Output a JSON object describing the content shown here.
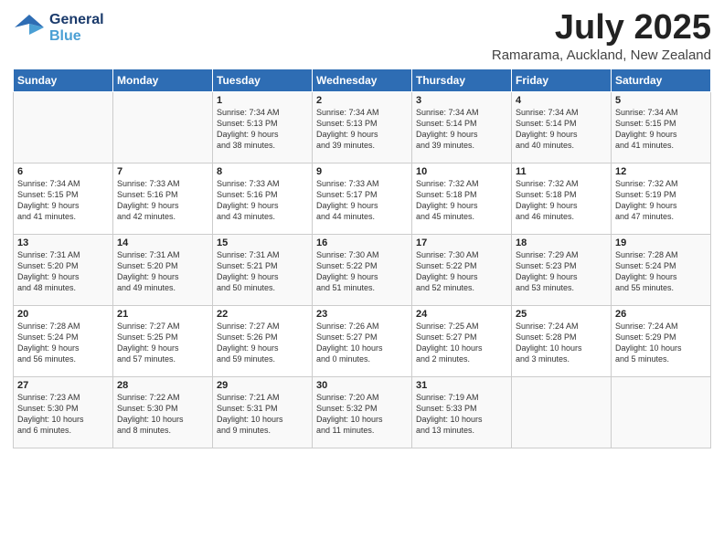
{
  "header": {
    "logo_line1": "General",
    "logo_line2": "Blue",
    "month": "July 2025",
    "location": "Ramarama, Auckland, New Zealand"
  },
  "days_of_week": [
    "Sunday",
    "Monday",
    "Tuesday",
    "Wednesday",
    "Thursday",
    "Friday",
    "Saturday"
  ],
  "weeks": [
    [
      {
        "day": "",
        "info": ""
      },
      {
        "day": "",
        "info": ""
      },
      {
        "day": "1",
        "info": "Sunrise: 7:34 AM\nSunset: 5:13 PM\nDaylight: 9 hours\nand 38 minutes."
      },
      {
        "day": "2",
        "info": "Sunrise: 7:34 AM\nSunset: 5:13 PM\nDaylight: 9 hours\nand 39 minutes."
      },
      {
        "day": "3",
        "info": "Sunrise: 7:34 AM\nSunset: 5:14 PM\nDaylight: 9 hours\nand 39 minutes."
      },
      {
        "day": "4",
        "info": "Sunrise: 7:34 AM\nSunset: 5:14 PM\nDaylight: 9 hours\nand 40 minutes."
      },
      {
        "day": "5",
        "info": "Sunrise: 7:34 AM\nSunset: 5:15 PM\nDaylight: 9 hours\nand 41 minutes."
      }
    ],
    [
      {
        "day": "6",
        "info": "Sunrise: 7:34 AM\nSunset: 5:15 PM\nDaylight: 9 hours\nand 41 minutes."
      },
      {
        "day": "7",
        "info": "Sunrise: 7:33 AM\nSunset: 5:16 PM\nDaylight: 9 hours\nand 42 minutes."
      },
      {
        "day": "8",
        "info": "Sunrise: 7:33 AM\nSunset: 5:16 PM\nDaylight: 9 hours\nand 43 minutes."
      },
      {
        "day": "9",
        "info": "Sunrise: 7:33 AM\nSunset: 5:17 PM\nDaylight: 9 hours\nand 44 minutes."
      },
      {
        "day": "10",
        "info": "Sunrise: 7:32 AM\nSunset: 5:18 PM\nDaylight: 9 hours\nand 45 minutes."
      },
      {
        "day": "11",
        "info": "Sunrise: 7:32 AM\nSunset: 5:18 PM\nDaylight: 9 hours\nand 46 minutes."
      },
      {
        "day": "12",
        "info": "Sunrise: 7:32 AM\nSunset: 5:19 PM\nDaylight: 9 hours\nand 47 minutes."
      }
    ],
    [
      {
        "day": "13",
        "info": "Sunrise: 7:31 AM\nSunset: 5:20 PM\nDaylight: 9 hours\nand 48 minutes."
      },
      {
        "day": "14",
        "info": "Sunrise: 7:31 AM\nSunset: 5:20 PM\nDaylight: 9 hours\nand 49 minutes."
      },
      {
        "day": "15",
        "info": "Sunrise: 7:31 AM\nSunset: 5:21 PM\nDaylight: 9 hours\nand 50 minutes."
      },
      {
        "day": "16",
        "info": "Sunrise: 7:30 AM\nSunset: 5:22 PM\nDaylight: 9 hours\nand 51 minutes."
      },
      {
        "day": "17",
        "info": "Sunrise: 7:30 AM\nSunset: 5:22 PM\nDaylight: 9 hours\nand 52 minutes."
      },
      {
        "day": "18",
        "info": "Sunrise: 7:29 AM\nSunset: 5:23 PM\nDaylight: 9 hours\nand 53 minutes."
      },
      {
        "day": "19",
        "info": "Sunrise: 7:28 AM\nSunset: 5:24 PM\nDaylight: 9 hours\nand 55 minutes."
      }
    ],
    [
      {
        "day": "20",
        "info": "Sunrise: 7:28 AM\nSunset: 5:24 PM\nDaylight: 9 hours\nand 56 minutes."
      },
      {
        "day": "21",
        "info": "Sunrise: 7:27 AM\nSunset: 5:25 PM\nDaylight: 9 hours\nand 57 minutes."
      },
      {
        "day": "22",
        "info": "Sunrise: 7:27 AM\nSunset: 5:26 PM\nDaylight: 9 hours\nand 59 minutes."
      },
      {
        "day": "23",
        "info": "Sunrise: 7:26 AM\nSunset: 5:27 PM\nDaylight: 10 hours\nand 0 minutes."
      },
      {
        "day": "24",
        "info": "Sunrise: 7:25 AM\nSunset: 5:27 PM\nDaylight: 10 hours\nand 2 minutes."
      },
      {
        "day": "25",
        "info": "Sunrise: 7:24 AM\nSunset: 5:28 PM\nDaylight: 10 hours\nand 3 minutes."
      },
      {
        "day": "26",
        "info": "Sunrise: 7:24 AM\nSunset: 5:29 PM\nDaylight: 10 hours\nand 5 minutes."
      }
    ],
    [
      {
        "day": "27",
        "info": "Sunrise: 7:23 AM\nSunset: 5:30 PM\nDaylight: 10 hours\nand 6 minutes."
      },
      {
        "day": "28",
        "info": "Sunrise: 7:22 AM\nSunset: 5:30 PM\nDaylight: 10 hours\nand 8 minutes."
      },
      {
        "day": "29",
        "info": "Sunrise: 7:21 AM\nSunset: 5:31 PM\nDaylight: 10 hours\nand 9 minutes."
      },
      {
        "day": "30",
        "info": "Sunrise: 7:20 AM\nSunset: 5:32 PM\nDaylight: 10 hours\nand 11 minutes."
      },
      {
        "day": "31",
        "info": "Sunrise: 7:19 AM\nSunset: 5:33 PM\nDaylight: 10 hours\nand 13 minutes."
      },
      {
        "day": "",
        "info": ""
      },
      {
        "day": "",
        "info": ""
      }
    ]
  ]
}
